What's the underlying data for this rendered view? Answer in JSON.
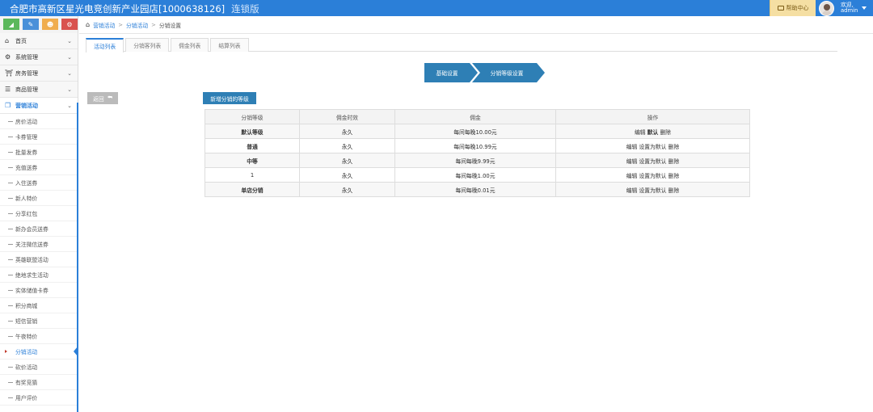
{
  "header": {
    "title": "合肥市高新区星光电竞创新产业园店[1000638126]",
    "edition": "连锁版",
    "help_label": "帮助中心",
    "user_greeting": "欢迎,",
    "user_name": "admin"
  },
  "colors": {
    "topbar": "#2b7fd8",
    "accent": "#2b7fd8",
    "step": "#2e7fb5",
    "shortcut_colors": [
      "#5cb85c",
      "#4a90d9",
      "#f0ad4e",
      "#d9534f"
    ]
  },
  "shortcuts": [
    {
      "icon": "signal-icon"
    },
    {
      "icon": "pencil-icon"
    },
    {
      "icon": "users-icon"
    },
    {
      "icon": "cogs-icon"
    }
  ],
  "sidebar": {
    "menus": [
      {
        "label": "首页",
        "icon": "home-icon"
      },
      {
        "label": "系统管理",
        "icon": "gear-icon"
      },
      {
        "label": "房务管理",
        "icon": "bank-icon"
      },
      {
        "label": "商品管理",
        "icon": "database-icon"
      },
      {
        "label": "营销活动",
        "icon": "gift-icon"
      }
    ],
    "sub_items": [
      "房价活动",
      "卡券管理",
      "批量发券",
      "充值送券",
      "入住送券",
      "新人特价",
      "分享红包",
      "新办会员送券",
      "关注微信送券",
      "英雄联盟活动",
      "绝地求生活动",
      "实体储值卡券",
      "积分商城",
      "短信营销",
      "午夜特价",
      "分销活动",
      "砍价活动",
      "有奖竞猜",
      "用户评价"
    ],
    "current_sub": "分销活动"
  },
  "breadcrumb": {
    "items": [
      "营销活动",
      "分销活动",
      "分销设置"
    ]
  },
  "tabs": [
    "活动列表",
    "分销客列表",
    "佣金列表",
    "结算列表"
  ],
  "steps": [
    "基础设置",
    "分销等级设置"
  ],
  "buttons": {
    "back": "返回",
    "add_level": "新增分销的等级"
  },
  "table": {
    "headers": [
      "分销等级",
      "佣金时效",
      "佣金",
      "操作"
    ],
    "rows": [
      {
        "level": "默认等级",
        "validity": "永久",
        "commission": "每间每晚10.00元",
        "ops": [
          "编辑",
          "默认",
          "删除"
        ]
      },
      {
        "level": "普通",
        "validity": "永久",
        "commission": "每间每晚10.99元",
        "ops": [
          "编辑",
          "设置为默认",
          "删除"
        ]
      },
      {
        "level": "中等",
        "validity": "永久",
        "commission": "每间每晚9.99元",
        "ops": [
          "编辑",
          "设置为默认",
          "删除"
        ]
      },
      {
        "level": "1",
        "validity": "永久",
        "commission": "每间每晚1.00元",
        "ops": [
          "编辑",
          "设置为默认",
          "删除"
        ]
      },
      {
        "level": "单店分销",
        "validity": "永久",
        "commission": "每间每晚0.01元",
        "ops": [
          "编辑",
          "设置为默认",
          "删除"
        ]
      }
    ]
  }
}
